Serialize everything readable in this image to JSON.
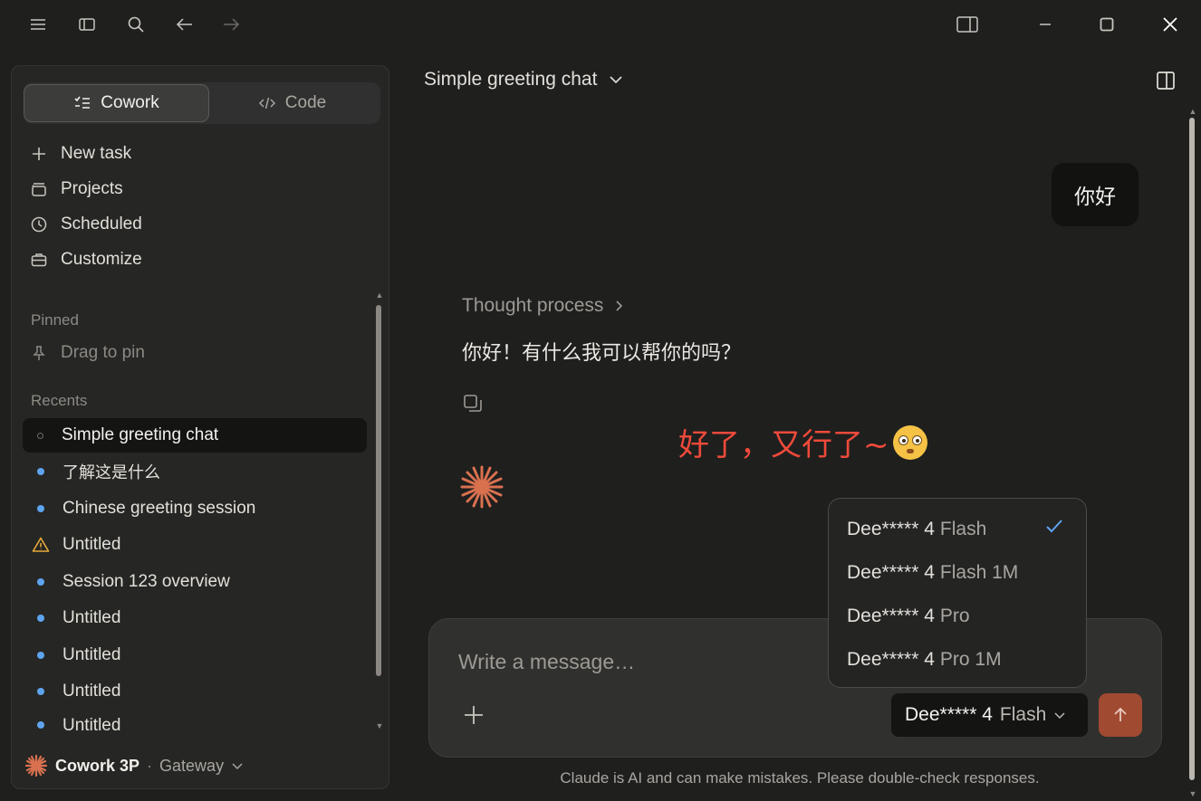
{
  "window": {
    "icons": [
      "menu-icon",
      "sidebar-toggle-icon",
      "search-icon",
      "back-arrow-icon",
      "forward-arrow-icon",
      "panel-layout-icon",
      "minimize-icon",
      "maximize-icon",
      "close-icon"
    ]
  },
  "sidebar": {
    "modes": {
      "cowork": "Cowork",
      "code": "Code",
      "active": "cowork"
    },
    "nav": [
      {
        "label": "New task",
        "icon": "plus-icon"
      },
      {
        "label": "Projects",
        "icon": "folder-icon"
      },
      {
        "label": "Scheduled",
        "icon": "clock-icon"
      },
      {
        "label": "Customize",
        "icon": "briefcase-icon"
      }
    ],
    "pinned_label": "Pinned",
    "pin_hint": "Drag to pin",
    "recents_label": "Recents",
    "recents": [
      {
        "label": "Simple greeting chat",
        "status": "idle"
      },
      {
        "label": "了解这是什么",
        "status": "active"
      },
      {
        "label": "Chinese greeting session",
        "status": "active"
      },
      {
        "label": "Untitled",
        "status": "warning"
      },
      {
        "label": "Session 123 overview",
        "status": "active"
      },
      {
        "label": "Untitled",
        "status": "active"
      },
      {
        "label": "Untitled",
        "status": "active"
      },
      {
        "label": "Untitled",
        "status": "active"
      },
      {
        "label": "Untitled",
        "status": "active"
      }
    ],
    "footer": {
      "brand": "Cowork 3P",
      "separator": "·",
      "gateway": "Gateway"
    }
  },
  "conversation": {
    "title": "Simple greeting chat",
    "user_message": "你好",
    "thought_label": "Thought process",
    "assistant_reply": "你好！有什么我可以帮你的吗？",
    "annotation_text": "好了，又行了~"
  },
  "composer": {
    "placeholder": "Write a message…",
    "model_name": "Dee***** 4",
    "model_variant": "Flash"
  },
  "model_menu": {
    "items": [
      {
        "name": "Dee***** 4",
        "variant": "Flash",
        "selected": true
      },
      {
        "name": "Dee***** 4",
        "variant": "Flash 1M",
        "selected": false
      },
      {
        "name": "Dee***** 4",
        "variant": "Pro",
        "selected": false
      },
      {
        "name": "Dee***** 4",
        "variant": "Pro 1M",
        "selected": false
      }
    ]
  },
  "disclaimer": "Claude is AI and can make mistakes. Please double-check responses.",
  "colors": {
    "background": "#1f1f1e",
    "sidebar": "#262624",
    "accent_blue": "#5ea4f0",
    "brand_orange": "#d9714f",
    "send_button": "#a04a32",
    "annotation_red": "#ef4a3a",
    "warning": "#e7a93a"
  }
}
